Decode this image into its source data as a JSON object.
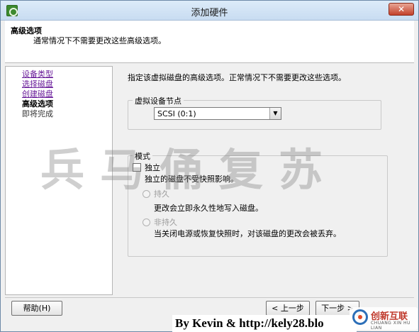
{
  "window": {
    "title": "添加硬件",
    "close_label": "✕"
  },
  "header": {
    "title": "高级选项",
    "subtitle": "通常情况下不需要更改这些高级选项。"
  },
  "nav": {
    "items": [
      {
        "label": "设备类型",
        "state": "link"
      },
      {
        "label": "选择磁盘",
        "state": "link"
      },
      {
        "label": "创建磁盘",
        "state": "link"
      },
      {
        "label": "高级选项",
        "state": "current"
      },
      {
        "label": "即将完成",
        "state": "pending"
      }
    ]
  },
  "main": {
    "intro": "指定该虚拟磁盘的高级选项。正常情况下不需要更改这些选项。",
    "device_node": {
      "group_label": "虚拟设备节点",
      "selected": "SCSI (0:1)"
    },
    "mode": {
      "group_label": "模式",
      "independent": {
        "label": "独立",
        "checked": false,
        "description": "独立的磁盘不受快照影响。"
      },
      "persistent": {
        "label": "持久",
        "description": "更改会立即永久性地写入磁盘。"
      },
      "nonpersistent": {
        "label": "非持久",
        "description": "当关闭电源或恢复快照时，对该磁盘的更改会被丢弃。"
      }
    }
  },
  "buttons": {
    "help": "帮助(H)",
    "back": "< 上一步",
    "next": "下一步 >"
  },
  "watermark": "兵马俑复苏",
  "credit": "By Kevin & http://kely28.blo",
  "brand": {
    "name": "创新互联",
    "sub": "CHUANG XIN HU LIAN"
  },
  "colors": {
    "link": "#6a1d9a",
    "accent": "#2c6fb8"
  }
}
